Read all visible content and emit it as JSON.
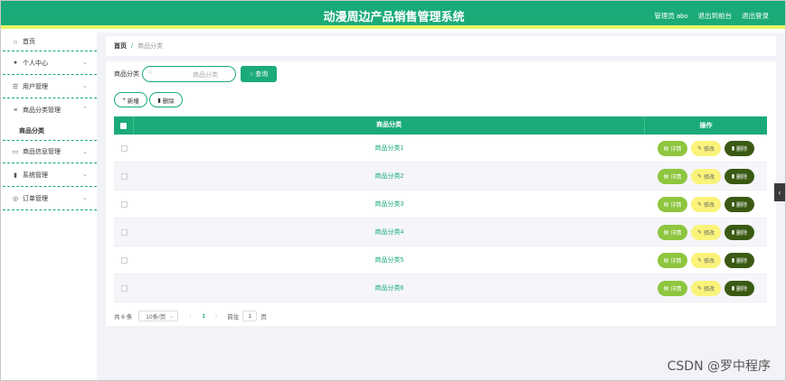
{
  "header": {
    "title": "动漫周边产品销售管理系统",
    "user_label": "管理员 abo",
    "back_label": "退出到前台",
    "logout_label": "退出登录"
  },
  "sidebar": {
    "items": [
      {
        "label": "首页",
        "icon": "home-icon"
      },
      {
        "label": "个人中心",
        "icon": "user-icon"
      },
      {
        "label": "用户管理",
        "icon": "sliders-icon"
      },
      {
        "label": "商品分类管理",
        "icon": "list-icon"
      },
      {
        "label": "商品分类",
        "sub": true
      },
      {
        "label": "商品信息管理",
        "icon": "message-icon"
      },
      {
        "label": "系统管理",
        "icon": "trash-icon"
      },
      {
        "label": "订单管理",
        "icon": "compass-icon"
      }
    ]
  },
  "breadcrumb": {
    "home": "首页",
    "separator": "/",
    "current": "商品分类"
  },
  "search": {
    "label": "商品分类",
    "placeholder": "商品分类",
    "button": "查询"
  },
  "actions": {
    "add": "新增",
    "delete": "删除"
  },
  "table": {
    "headers": {
      "name": "商品分类",
      "ops": "操作"
    },
    "rows": [
      "商品分类1",
      "商品分类2",
      "商品分类3",
      "商品分类4",
      "商品分类5",
      "商品分类6"
    ],
    "op_labels": {
      "detail": "详情",
      "edit": "修改",
      "remove": "删除"
    }
  },
  "pagination": {
    "total": "共 6 条",
    "page_size": "10条/页",
    "current_page": "1",
    "goto_label": "前往",
    "goto_value": "1",
    "page_unit": "页"
  },
  "colors": {
    "primary": "#1aab78",
    "accent_bar": "#e6f564",
    "detail": "#8ec63f",
    "edit": "#faf37a",
    "remove": "#3a5a14"
  },
  "watermark": "CSDN @罗中程序"
}
